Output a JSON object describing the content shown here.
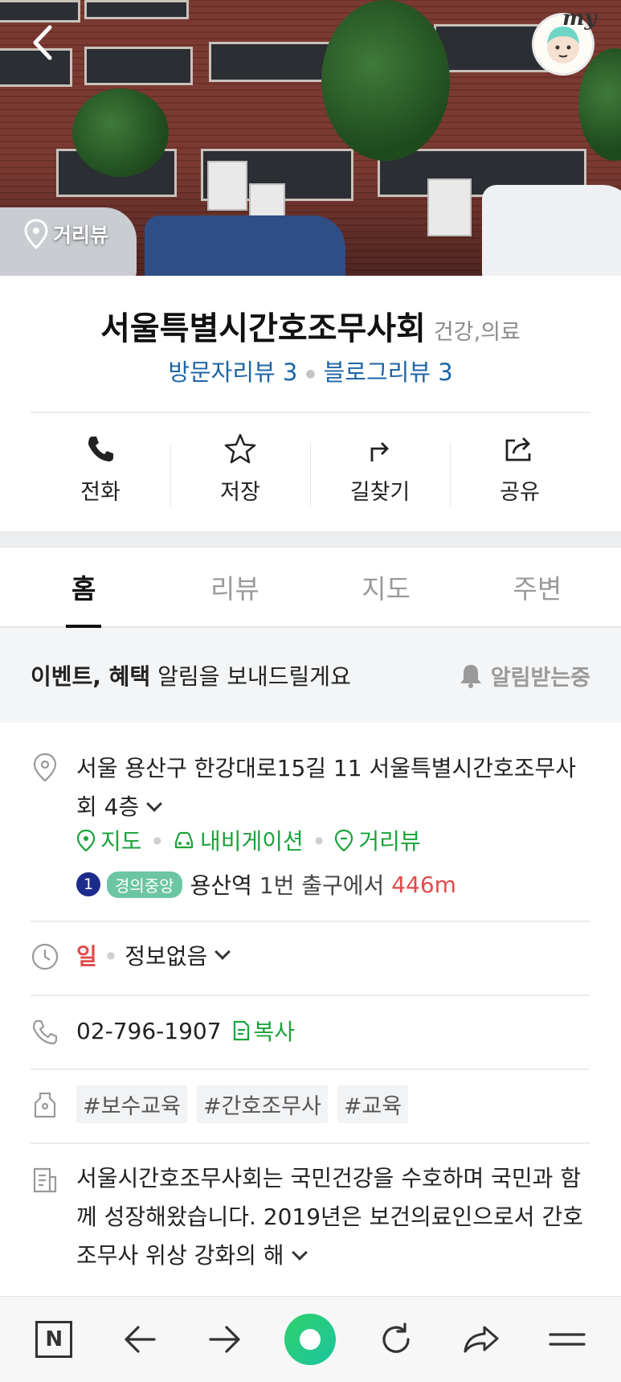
{
  "header": {
    "my_label": "my",
    "street_view_label": "거리뷰"
  },
  "place": {
    "name": "서울특별시간호조무사회",
    "category": "건강,의료",
    "visitor_reviews": "방문자리뷰 3",
    "blog_reviews": "블로그리뷰 3"
  },
  "actions": [
    {
      "label": "전화",
      "icon": "phone-icon"
    },
    {
      "label": "저장",
      "icon": "star-icon"
    },
    {
      "label": "길찾기",
      "icon": "directions-icon"
    },
    {
      "label": "공유",
      "icon": "share-icon"
    }
  ],
  "tabs": [
    {
      "label": "홈",
      "active": true
    },
    {
      "label": "리뷰",
      "active": false
    },
    {
      "label": "지도",
      "active": false
    },
    {
      "label": "주변",
      "active": false
    }
  ],
  "notice": {
    "bold": "이벤트, 혜택",
    "text": " 알림을 보내드릴게요",
    "button": "알림받는중"
  },
  "address": {
    "text": "서울 용산구 한강대로15길 11 서울특별시간호조무사회 4층",
    "links": [
      "지도",
      "내비게이션",
      "거리뷰"
    ]
  },
  "subway": {
    "line_number": "1",
    "line_name": "경의중앙",
    "station": "용산역",
    "exit_text": " 1번 출구에서 ",
    "distance": "446m"
  },
  "hours": {
    "day": "일",
    "status": "정보없음"
  },
  "phone": {
    "number": "02-796-1907",
    "copy_label": "복사"
  },
  "tags": [
    "#보수교육",
    "#간호조무사",
    "#교육"
  ],
  "description": "서울시간호조무사회는 국민건강을 수호하며 국민과 함께 성장해왔습니다. 2019년은 보건의료인으로서 간호조무사 위상 강화의 해",
  "colors": {
    "accent_green": "#1aa33b",
    "review_blue": "#1f64a6",
    "warning_red": "#e24b4b"
  }
}
